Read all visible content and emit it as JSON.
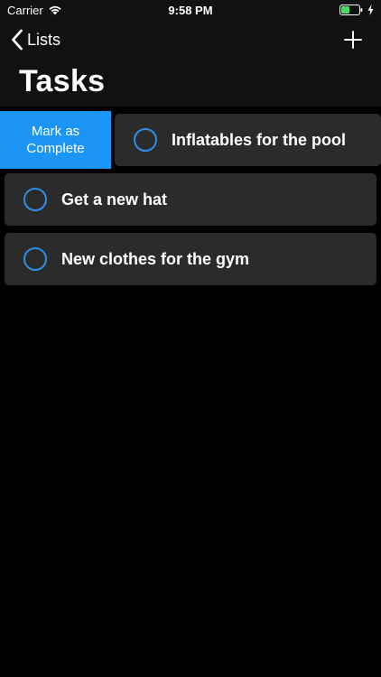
{
  "status_bar": {
    "carrier": "Carrier",
    "time": "9:58 PM"
  },
  "nav": {
    "back_label": "Lists",
    "title": "Tasks"
  },
  "swipe_action": {
    "label_line1": "Mark as",
    "label_line2": "Complete"
  },
  "tasks": [
    {
      "label": "Inflatables for the pool"
    },
    {
      "label": "Get a new hat"
    },
    {
      "label": "New clothes for the gym"
    }
  ],
  "colors": {
    "accent": "#1b96f7",
    "circle": "#2f8fe8",
    "row_bg": "#2b2b2b",
    "battery": "#4cd964"
  },
  "icons": {
    "back": "chevron-left-icon",
    "add": "plus-icon",
    "wifi": "wifi-icon",
    "battery": "battery-icon",
    "charging": "bolt-icon"
  }
}
